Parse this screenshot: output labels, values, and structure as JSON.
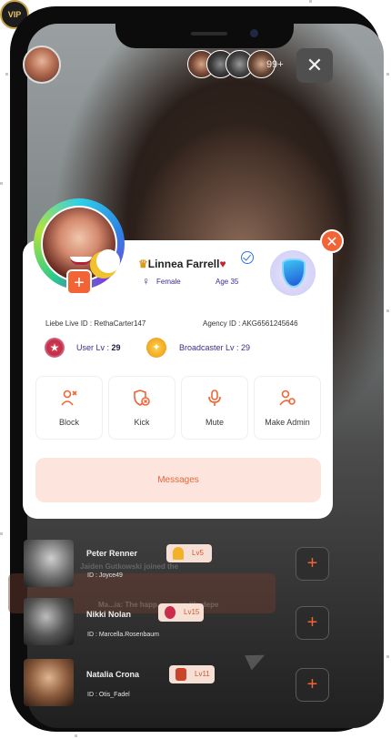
{
  "header": {
    "viewer_count": "99+",
    "close_label": "✕"
  },
  "profile_card": {
    "name": "Linnea Farrell",
    "gender": "Female",
    "age": "Age 35",
    "live_id": "Liebe Live ID : RethaCarter147",
    "agency_id": "Agency ID : AKG6561245646",
    "user_lv_label": "User Lv : ",
    "user_lv_value": "29",
    "broadcaster_lv_label": "Broadcaster Lv : 29",
    "vip_label": "VIP",
    "add_label": "+",
    "close_label": "✕",
    "actions": [
      {
        "label": "Block",
        "icon": "block-user-icon"
      },
      {
        "label": "Kick",
        "icon": "kick-shield-icon"
      },
      {
        "label": "Mute",
        "icon": "microphone-icon"
      },
      {
        "label": "Make Admin",
        "icon": "make-admin-icon"
      }
    ],
    "messages_label": "Messages"
  },
  "users": [
    {
      "name": "Peter Renner",
      "id": "ID : Joyce49",
      "level": "Lv5"
    },
    {
      "name": "Nikki Nolan",
      "id": "ID : Marcella.Rosenbaum",
      "level": "Lv15"
    },
    {
      "name": "Natalia Crona",
      "id": "ID : Otis_Fadel",
      "level": "Lv11"
    }
  ],
  "add_label": "+",
  "colors": {
    "accent": "#f26435",
    "messages_bg": "#fde4dc",
    "level_text": "#3a2e8f"
  }
}
